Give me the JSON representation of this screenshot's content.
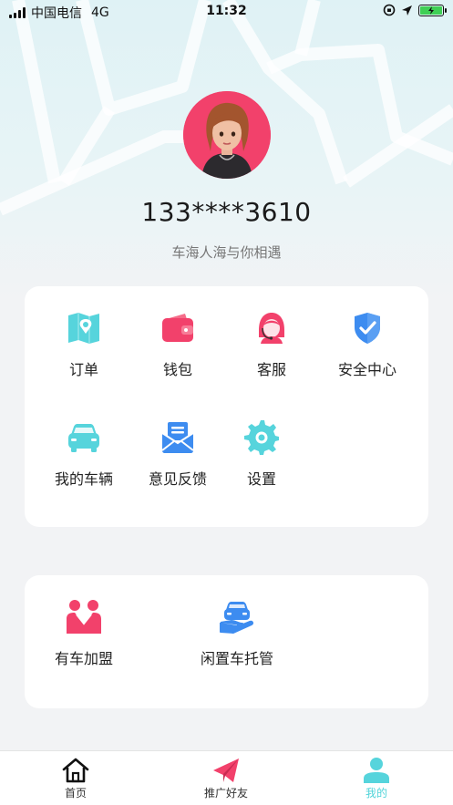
{
  "status_bar": {
    "carrier": "中国电信",
    "network": "4G",
    "time": "11:32"
  },
  "profile": {
    "phone": "133****3610",
    "motto": "车海人海与你相遇"
  },
  "menu": {
    "items": [
      {
        "label": "订单",
        "icon": "map-icon"
      },
      {
        "label": "钱包",
        "icon": "wallet-icon"
      },
      {
        "label": "客服",
        "icon": "customer-service-icon"
      },
      {
        "label": "安全中心",
        "icon": "shield-check-icon"
      },
      {
        "label": "我的车辆",
        "icon": "car-icon"
      },
      {
        "label": "意见反馈",
        "icon": "mail-icon"
      },
      {
        "label": "设置",
        "icon": "gear-icon"
      }
    ]
  },
  "services": {
    "items": [
      {
        "label": "有车加盟",
        "icon": "partners-icon"
      },
      {
        "label": "闲置车托管",
        "icon": "car-in-hand-icon"
      }
    ]
  },
  "tabbar": {
    "tabs": [
      {
        "label": "首页",
        "icon": "home-icon"
      },
      {
        "label": "推广好友",
        "icon": "paper-plane-icon"
      },
      {
        "label": "我的",
        "icon": "user-icon"
      }
    ],
    "active": "我的"
  },
  "colors": {
    "teal": "#56d4dc",
    "pink": "#f2416b",
    "blue": "#3d8cf0",
    "active_tab": "#4fd3d8"
  }
}
